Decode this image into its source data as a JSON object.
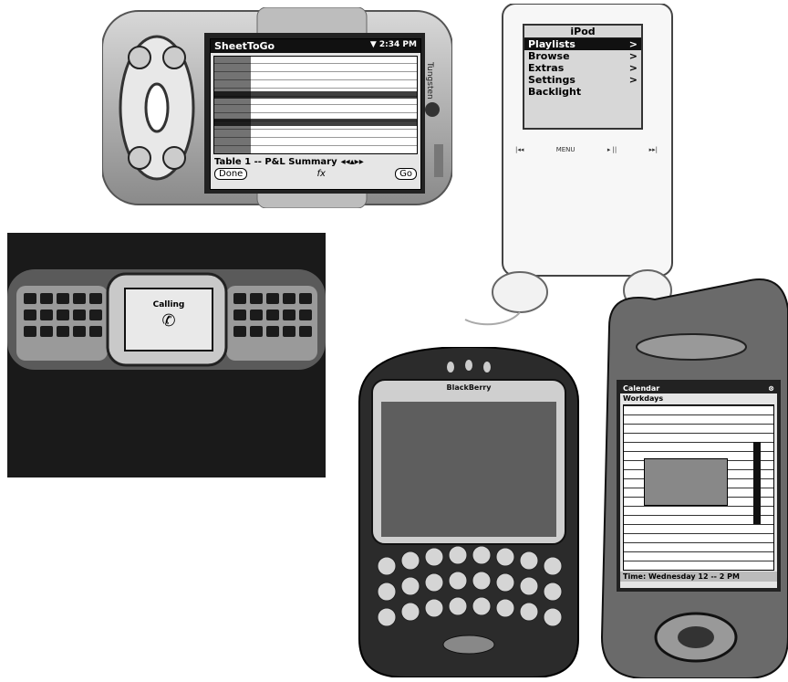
{
  "clie": {
    "app_title": "SheetToGo",
    "clock": "▼ 2:34 PM",
    "sheet_footer": "Table 1 -- P&L Summary",
    "done_label": "Done",
    "go_label": "Go",
    "fx_label": "fx",
    "brand": "Tungsten"
  },
  "ipod": {
    "title": "iPod",
    "menu": [
      "Playlists",
      "Browse",
      "Extras",
      "Settings",
      "Backlight"
    ],
    "wheel_labels": [
      "|◂◂",
      "MENU",
      "▸ ||",
      "▸▸|"
    ]
  },
  "nokia": {
    "screen_text": "Calling"
  },
  "blackberry": {
    "brand": "BlackBerry"
  },
  "pda": {
    "app_title": "Calendar",
    "view_label": "Workdays",
    "footer_text": "Time: Wednesday 12 -- 2 PM"
  }
}
